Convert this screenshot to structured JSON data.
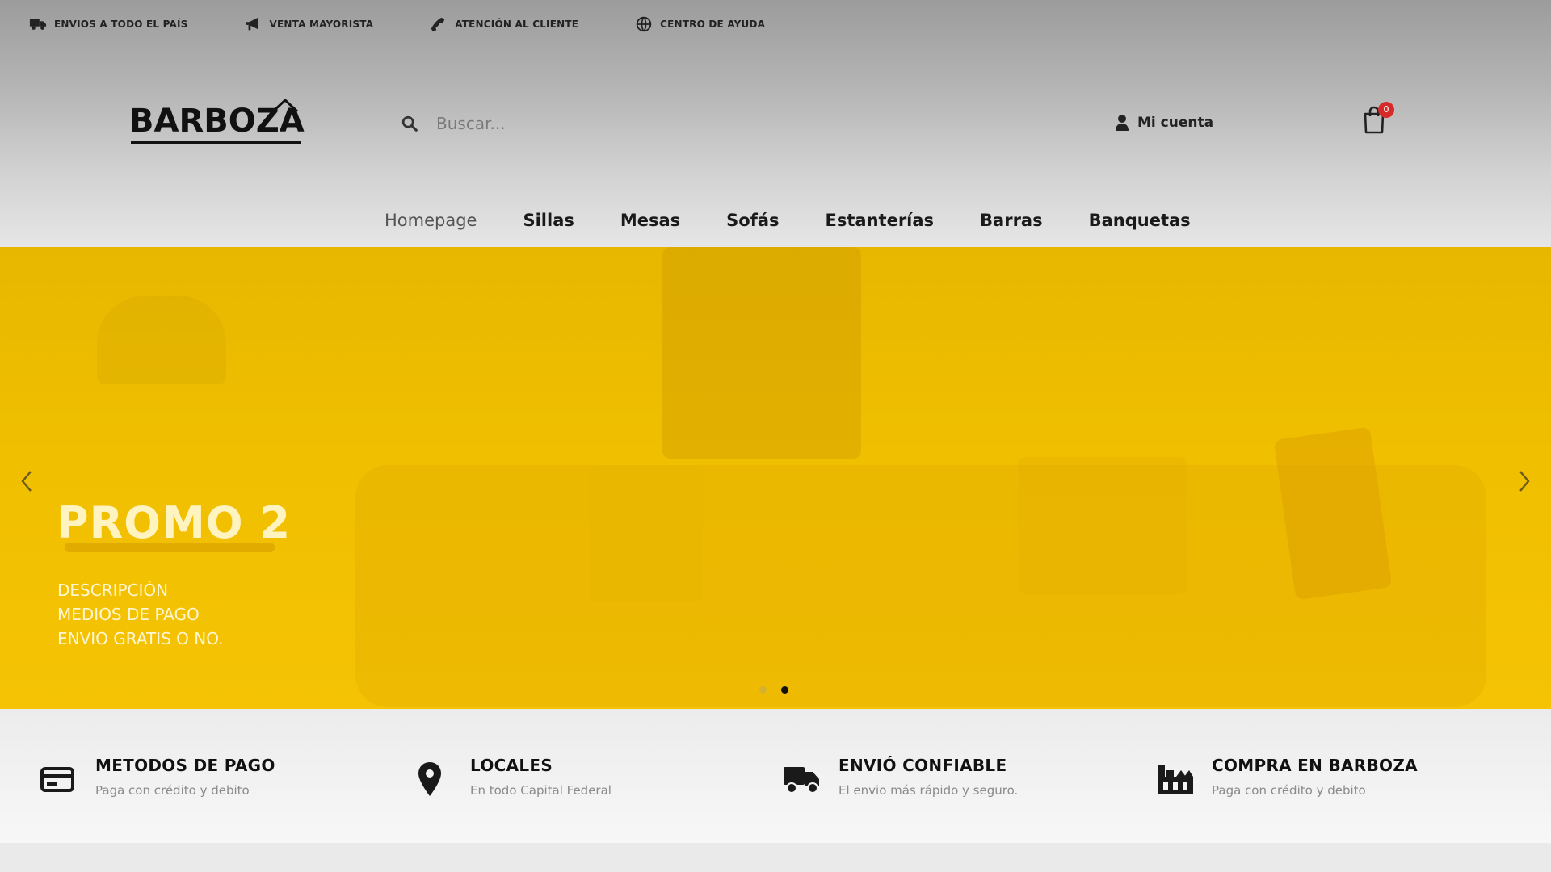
{
  "topbar": {
    "items": [
      {
        "label": "ENVIOS A TODO EL PAÍS",
        "icon": "truck-icon"
      },
      {
        "label": "VENTA MAYORISTA",
        "icon": "megaphone-icon"
      },
      {
        "label": "ATENCIÓN AL CLIENTE",
        "icon": "phone-icon"
      },
      {
        "label": "CENTRO DE AYUDA",
        "icon": "globe-icon"
      }
    ]
  },
  "header": {
    "logo_text": "BARBOZA",
    "search_placeholder": "Buscar...",
    "account_label": "Mi cuenta",
    "cart_count": "0"
  },
  "nav": {
    "items": [
      {
        "label": "Homepage",
        "active": true
      },
      {
        "label": "Sillas"
      },
      {
        "label": "Mesas"
      },
      {
        "label": "Sofás"
      },
      {
        "label": "Estanterías"
      },
      {
        "label": "Barras"
      },
      {
        "label": "Banquetas"
      }
    ]
  },
  "hero": {
    "title": "PROMO 2",
    "desc_lines": [
      "DESCRIPCIÓN",
      "MEDIOS DE PAGO",
      "ENVIO GRATIS O NO."
    ],
    "slide_count": 2,
    "active_slide": 2,
    "accent_color": "#f0bf00"
  },
  "features": [
    {
      "title": "METODOS DE PAGO",
      "subtitle": "Paga con crédito y debito",
      "icon": "credit-card-icon"
    },
    {
      "title": "LOCALES",
      "subtitle": "En todo Capital Federal",
      "icon": "map-pin-icon"
    },
    {
      "title": "ENVIÓ CONFIABLE",
      "subtitle": "El envio más rápido y seguro.",
      "icon": "truck-icon"
    },
    {
      "title": "COMPRA EN BARBOZA",
      "subtitle": "Paga con crédito y debito",
      "icon": "store-icon"
    }
  ]
}
